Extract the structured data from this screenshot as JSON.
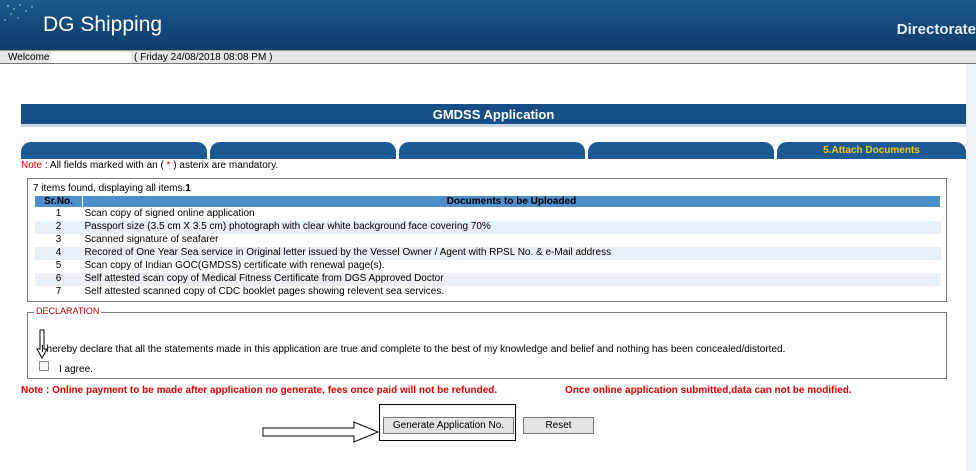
{
  "header": {
    "logo_text": "DG Shipping",
    "right_text": "Directorate"
  },
  "welcome": {
    "label": "Welcome",
    "datetime": "( Friday 24/08/2018 08:08 PM )"
  },
  "page_title": "GMDSS Application",
  "tabs": [
    {
      "label": ""
    },
    {
      "label": ""
    },
    {
      "label": ""
    },
    {
      "label": ""
    },
    {
      "label": "5.Attach Documents"
    }
  ],
  "note_mandatory": {
    "prefix": "Note",
    "before": " : All fields marked with an ( ",
    "star": "*",
    "after": " ) asterix are mandatory."
  },
  "documents": {
    "found_text": "7 items found, displaying all items.",
    "found_page": "1",
    "columns": [
      "Sr.No.",
      "Documents to be Uploaded"
    ],
    "rows": [
      {
        "sr": "1",
        "doc": "Scan copy of signed online application"
      },
      {
        "sr": "2",
        "doc": "Passport size (3.5 cm X 3.5 cm) photograph with clear white background face covering 70%"
      },
      {
        "sr": "3",
        "doc": "Scanned signature of seafarer"
      },
      {
        "sr": "4",
        "doc": "Recored of One Year Sea service in Original letter issued by the Vessel Owner / Agent with RPSL No. & e-Mail address"
      },
      {
        "sr": "5",
        "doc": "Scan copy of Indian GOC(GMDSS) certificate with renewal page(s)."
      },
      {
        "sr": "6",
        "doc": "Self attested scan copy of Medical Fitness Certificate from DGS Approved Doctor"
      },
      {
        "sr": "7",
        "doc": "Self attested scanned copy of CDC booklet pages showing relevent sea services."
      }
    ]
  },
  "declaration": {
    "legend": "DECLARATION",
    "statement": "I hereby declare that all the statements made in this application are true and complete to the best of my knowledge and belief and nothing has been concealed/distorted.",
    "agree_label": "I agree."
  },
  "bottom_notes": {
    "note1": "Note : Online payment to be made after application no generate, fees once paid will not be refunded.",
    "note2": "Once online application submitted,data can not be modified."
  },
  "buttons": {
    "generate": "Generate Application No.",
    "reset": "Reset"
  },
  "colors": {
    "banner": "#14487a",
    "title_bar": "#164f86",
    "tab": "#1d5a94",
    "active_tab_text": "#f5c518",
    "table_header": "#4e8fcb",
    "note_red": "#e00000"
  }
}
